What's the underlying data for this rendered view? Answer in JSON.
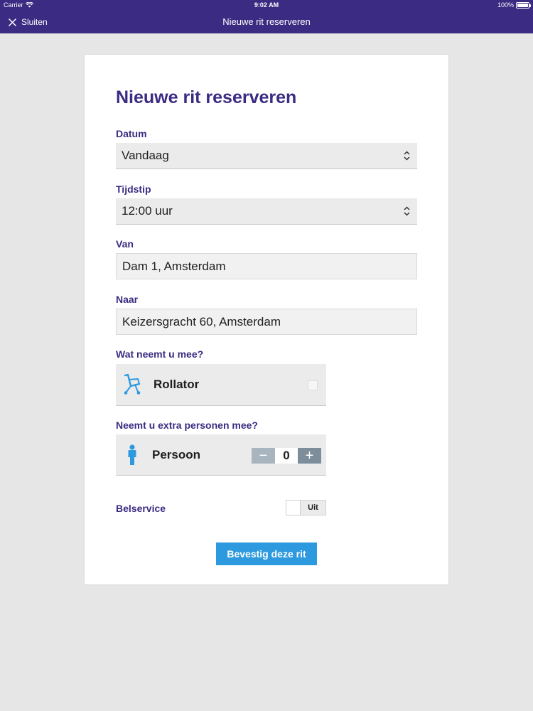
{
  "status_bar": {
    "carrier": "Carrier",
    "time": "9:02 AM",
    "battery": "100%",
    "battery_level": 1.0
  },
  "nav": {
    "close_label": "Sluiten",
    "title": "Nieuwe rit reserveren"
  },
  "form": {
    "heading": "Nieuwe rit reserveren",
    "date": {
      "label": "Datum",
      "value": "Vandaag"
    },
    "time": {
      "label": "Tijdstip",
      "value": "12:00 uur"
    },
    "from": {
      "label": "Van",
      "value": "Dam 1, Amsterdam"
    },
    "to": {
      "label": "Naar",
      "value": "Keizersgracht 60, Amsterdam"
    },
    "items": {
      "label": "Wat neemt u mee?",
      "rollator_label": "Rollator",
      "rollator_checked": false
    },
    "persons": {
      "label": "Neemt u extra personen mee?",
      "person_label": "Persoon",
      "minus": "−",
      "count": "0",
      "plus": "+"
    },
    "call_service": {
      "label": "Belservice",
      "state": "Uit"
    },
    "submit_label": "Bevestig deze rit"
  },
  "colors": {
    "brand": "#3b2b82",
    "button": "#2d9ae0",
    "icon": "#2d9ae0",
    "background": "#e6e6e6"
  }
}
